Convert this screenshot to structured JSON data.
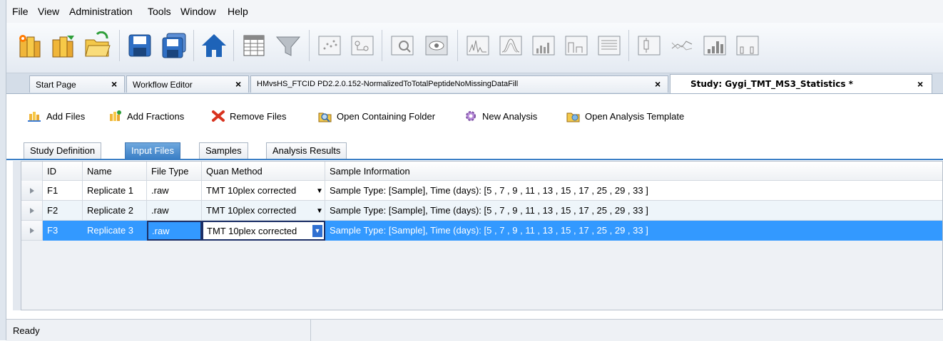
{
  "menu": [
    "File",
    "View",
    "Administration",
    "Tools",
    "Window",
    "Help"
  ],
  "toolbar": {
    "icons": [
      "new-study-icon",
      "open-study-icon",
      "open-folder-icon",
      "save-icon",
      "save-all-icon",
      "home-icon",
      "table-icon",
      "filter-icon",
      "scatter-view-icon",
      "flow-view-icon",
      "zoom-view-icon",
      "eye-view-icon",
      "spectrum-icon",
      "chromatogram-icon",
      "bar-chart-icon",
      "step-chart-icon",
      "list-view-icon",
      "box-plot-icon",
      "trend-icon",
      "histogram-icon",
      "histogram-2-icon"
    ]
  },
  "doc_tabs": [
    {
      "label": "Start Page",
      "close": "×"
    },
    {
      "label": "Workflow Editor",
      "close": "×"
    },
    {
      "label": "HMvsHS_FTCID PD2.2.0.152-NormalizedToTotalPeptideNoMissingDataFill",
      "close": "×"
    },
    {
      "label": "Study: Gygi_TMT_MS3_Statistics *",
      "close": "×"
    }
  ],
  "actions": {
    "add_files": "Add Files",
    "add_fractions": "Add Fractions",
    "remove_files": "Remove Files",
    "open_folder": "Open Containing Folder",
    "new_analysis": "New Analysis",
    "open_template": "Open Analysis Template"
  },
  "sub_tabs": [
    "Study Definition",
    "Input Files",
    "Samples",
    "Analysis Results"
  ],
  "grid": {
    "headers": [
      "ID",
      "Name",
      "File Type",
      "Quan Method",
      "Sample Information"
    ],
    "rows": [
      {
        "id": "F1",
        "name": "Replicate 1",
        "type": ".raw",
        "quan": "TMT 10plex corrected",
        "info": "Sample Type: [Sample], Time (days): [5 , 7 , 9 , 11 , 13 , 15 , 17 , 25 , 29 , 33 ]"
      },
      {
        "id": "F2",
        "name": "Replicate 2",
        "type": ".raw",
        "quan": "TMT 10plex corrected",
        "info": "Sample Type: [Sample], Time (days): [5 , 7 , 9 , 11 , 13 , 15 , 17 , 25 , 29 , 33 ]"
      },
      {
        "id": "F3",
        "name": "Replicate 3",
        "type": ".raw",
        "quan": "TMT 10plex corrected",
        "info": "Sample Type: [Sample], Time (days): [5 , 7 , 9 , 11 , 13 , 15 , 17 , 25 , 29 , 33 ]"
      }
    ]
  },
  "status": {
    "text": "Ready"
  },
  "colors": {
    "selection": "#3399ff",
    "tab_active": "#3b7fc6"
  }
}
